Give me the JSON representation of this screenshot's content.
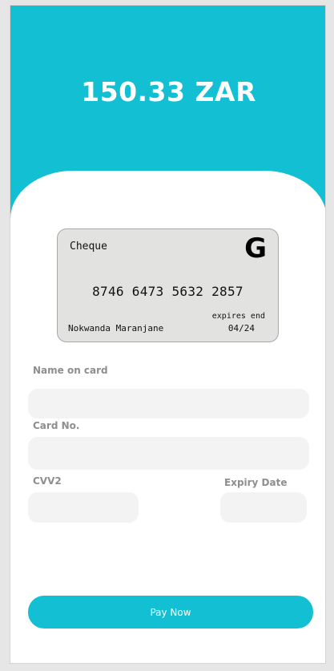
{
  "header": {
    "amount": "150.33 ZAR"
  },
  "card": {
    "type": "Cheque",
    "logo": "G",
    "number": "8746 6473 5632 2857",
    "expires_label": "expires end",
    "expiry": "04/24",
    "holder": "Nokwanda Maranjane"
  },
  "form": {
    "name_label": "Name on card",
    "name_value": "",
    "card_no_label": "Card No.",
    "card_no_value": "",
    "cvv_label": "CVV2",
    "cvv_value": "",
    "expiry_label": "Expiry Date",
    "expiry_value": ""
  },
  "actions": {
    "pay_label": "Pay Now"
  },
  "colors": {
    "accent": "#13c0d3",
    "field_bg": "#f4f3f3",
    "card_bg": "#e2e3e1",
    "label": "#8e8e8e"
  }
}
